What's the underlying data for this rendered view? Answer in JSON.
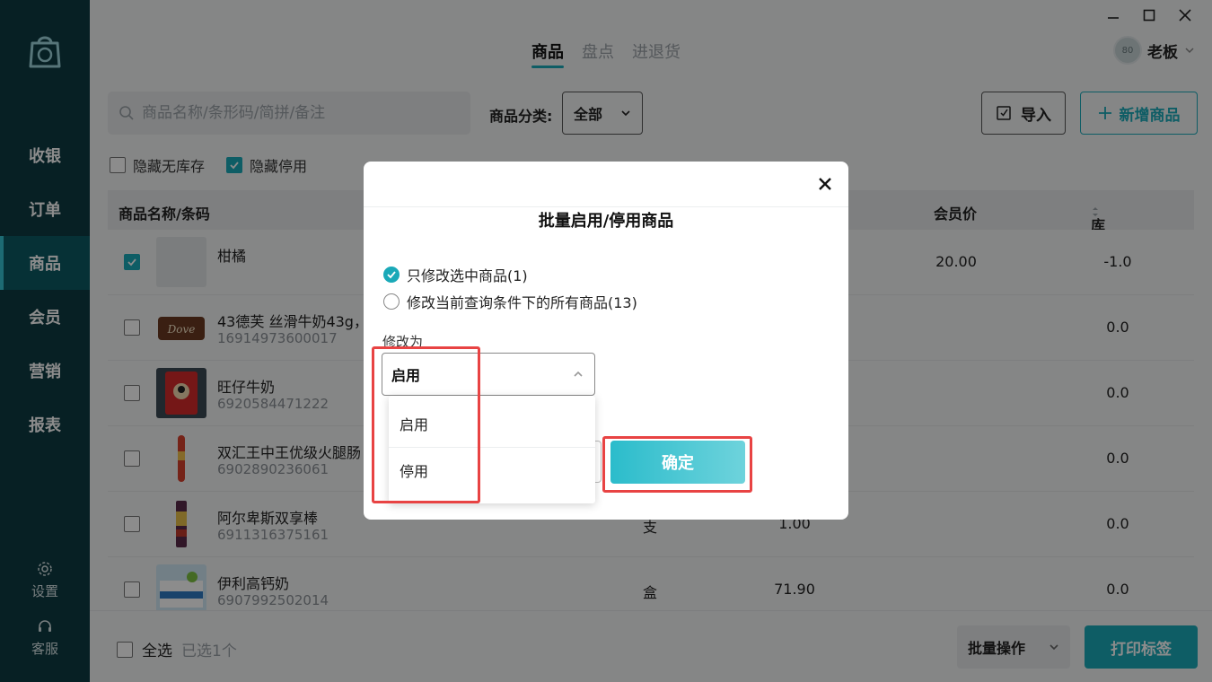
{
  "sidebar": {
    "nav": [
      "收银",
      "订单",
      "商品",
      "会员",
      "营销",
      "报表"
    ],
    "active_index": 2,
    "settings_label": "设置",
    "service_label": "客服"
  },
  "header": {
    "tabs": [
      "商品",
      "盘点",
      "进退货"
    ],
    "active_tab": 0,
    "user_name": "老板",
    "avatar_text": "80"
  },
  "toolbar": {
    "search_placeholder": "商品名称/条形码/简拼/备注",
    "category_label": "商品分类:",
    "category_value": "全部",
    "import_label": "导入",
    "add_label": "新增商品"
  },
  "filters": {
    "hide_no_stock": {
      "label": "隐藏无库存",
      "checked": false
    },
    "hide_disabled": {
      "label": "隐藏停用",
      "checked": true
    }
  },
  "table": {
    "headers": {
      "name": "商品名称/条码",
      "member_price": "会员价",
      "stock": "库存"
    },
    "rows": [
      {
        "name": "柑橘",
        "code": "",
        "unit": "",
        "price": "",
        "member_price": "20.00",
        "stock": "-1.0",
        "checked": true
      },
      {
        "name": "43德芙 丝滑牛奶43g，",
        "code": "16914973600017",
        "unit": "",
        "price": "",
        "member_price": "",
        "stock": "0.0",
        "checked": false
      },
      {
        "name": "旺仔牛奶",
        "code": "6920584471222",
        "unit": "",
        "price": "",
        "member_price": "",
        "stock": "0.0",
        "checked": false
      },
      {
        "name": "双汇王中王优级火腿肠",
        "code": "6902890236061",
        "unit": "",
        "price": "",
        "member_price": "",
        "stock": "0.0",
        "checked": false
      },
      {
        "name": "阿尔卑斯双享棒",
        "code": "6911316375161",
        "unit": "支",
        "price": "1.00",
        "member_price": "",
        "stock": "0.0",
        "checked": false
      },
      {
        "name": "伊利高钙奶",
        "code": "6907992502014",
        "unit": "盒",
        "price": "71.90",
        "member_price": "",
        "stock": "0.0",
        "checked": false
      }
    ]
  },
  "footer": {
    "select_all": "全选",
    "selected_count": "已选1个",
    "batch_label": "批量操作",
    "print_label": "打印标签"
  },
  "modal": {
    "title": "批量启用/停用商品",
    "option_selected": "只修改选中商品(1)",
    "option_all": "修改当前查询条件下的所有商品(13)",
    "modify_label": "修改为",
    "select_value": "启用",
    "options": [
      "启用",
      "停用"
    ],
    "confirm_label": "确定"
  },
  "colors": {
    "accent": "#1aa9b8",
    "sidebar": "#0e3b43",
    "highlight": "#e84343"
  }
}
